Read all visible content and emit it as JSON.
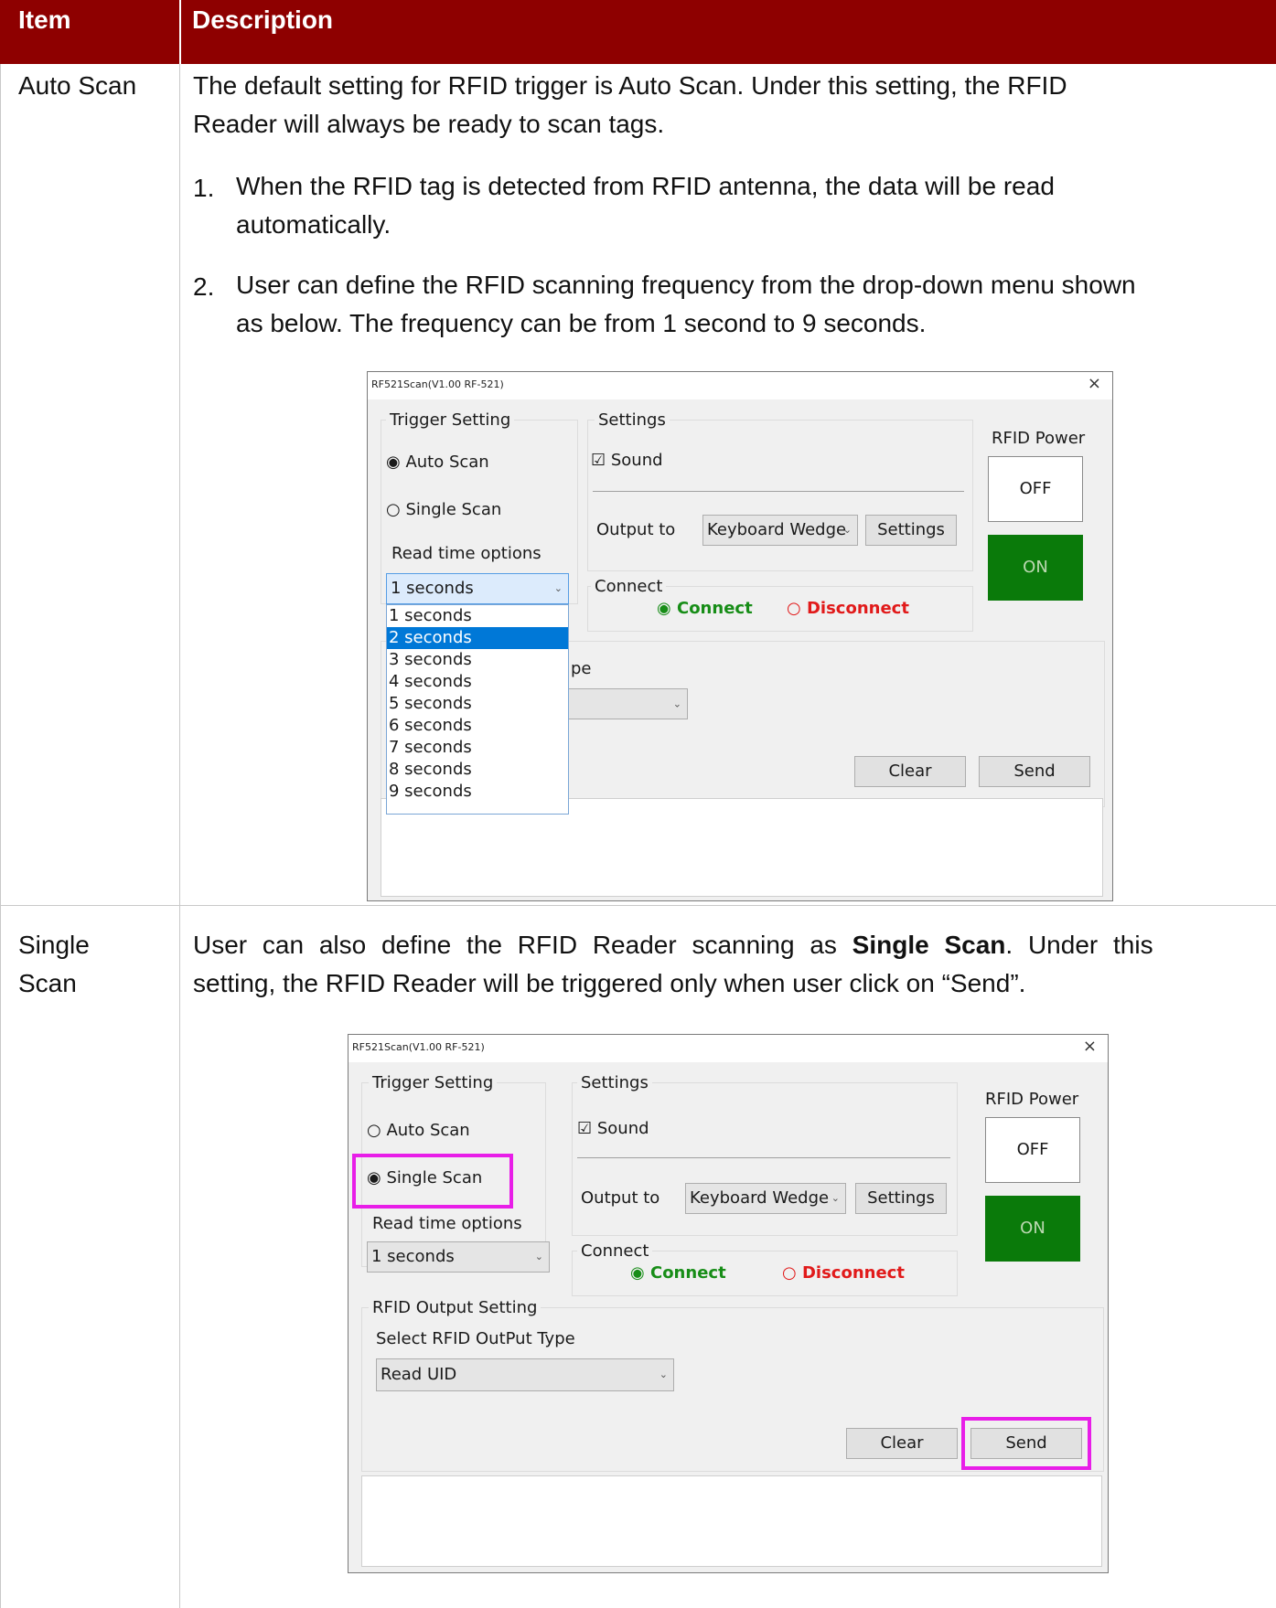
{
  "table": {
    "header": {
      "col1": "Item",
      "col2": "Description"
    },
    "rows": [
      {
        "item": "Auto Scan",
        "intro_line1": "The default setting for RFID trigger is Auto Scan. Under this setting, the RFID",
        "intro_line2": "Reader will always be ready to scan tags.",
        "steps": [
          {
            "num": "1.",
            "line1": "When the RFID tag is detected from RFID antenna, the data will be read",
            "line2": "automatically."
          },
          {
            "num": "2.",
            "line1": "User can define the RFID scanning frequency from the drop-down menu shown",
            "line2": "as below. The frequency can be from 1 second to 9 seconds."
          }
        ]
      },
      {
        "item_line1": "Single",
        "item_line2": "Scan",
        "desc_line1_prefix": "User can also define the RFID Reader scanning as ",
        "desc_line1_bold": "Single Scan",
        "desc_line1_suffix": ". Under this",
        "desc_line2": "setting, the RFID Reader will be triggered only when user click on “Send”."
      }
    ]
  },
  "window1": {
    "title": "RF521Scan(V1.00 RF-521)",
    "close": "×",
    "trigger_group": "Trigger Setting",
    "auto_scan": "Auto Scan",
    "single_scan": "Single Scan",
    "read_time_label": "Read time options",
    "read_time_value": "1 seconds",
    "dropdown_options": [
      "1 seconds",
      "2 seconds",
      "3 seconds",
      "4 seconds",
      "5 seconds",
      "6 seconds",
      "7 seconds",
      "8 seconds",
      "9 seconds"
    ],
    "dropdown_selected_index": 1,
    "settings_group": "Settings",
    "sound": "Sound",
    "output_to": "Output to",
    "output_value": "Keyboard Wedge",
    "settings_button": "Settings",
    "connect_group": "Connect",
    "connect": "Connect",
    "disconnect": "Disconnect",
    "rfid_power": "RFID Power",
    "off": "OFF",
    "on": "ON",
    "partial_label": "pe",
    "clear": "Clear",
    "send": "Send"
  },
  "window2": {
    "title": "RF521Scan(V1.00 RF-521)",
    "close": "×",
    "trigger_group": "Trigger Setting",
    "auto_scan": "Auto Scan",
    "single_scan": "Single Scan",
    "read_time_label": "Read time options",
    "read_time_value": "1 seconds",
    "settings_group": "Settings",
    "sound": "Sound",
    "output_to": "Output to",
    "output_value": "Keyboard Wedge",
    "settings_button": "Settings",
    "connect_group": "Connect",
    "connect": "Connect",
    "disconnect": "Disconnect",
    "rfid_power": "RFID Power",
    "off": "OFF",
    "on": "ON",
    "output_group": "RFID Output Setting",
    "output_type_label": "Select RFID OutPut Type",
    "output_type_value": "Read UID",
    "clear": "Clear",
    "send": "Send"
  },
  "colors": {
    "header_bg": "#8e0000",
    "highlight": "#e81ee8",
    "power_on": "#0a7a0a",
    "connect": "#178d17",
    "disconnect": "#e11a1a"
  }
}
